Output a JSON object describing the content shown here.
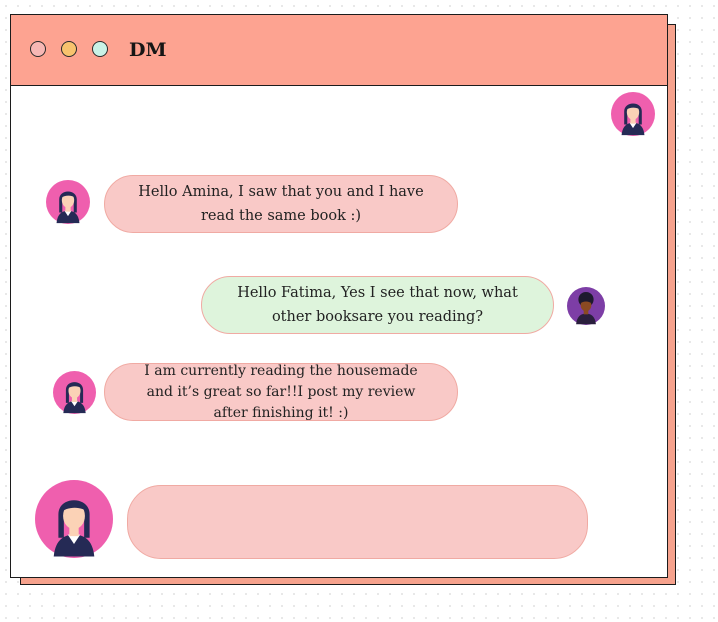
{
  "window": {
    "title": "DM",
    "controls": [
      "close-dot",
      "minimize-dot",
      "maximize-dot"
    ]
  },
  "colors": {
    "titlebar": "#fda391",
    "shadow_panel": "#f6a28d",
    "incoming_bubble": "#f9c9c7",
    "outgoing_bubble": "#def4dc",
    "avatar_pink": "#ef5fae",
    "avatar_purple": "#7d3ea6"
  },
  "messages": [
    {
      "sender": "Fatima",
      "side": "left",
      "text": "Hello Amina, I saw that you and I have read the same book :)"
    },
    {
      "sender": "Amina",
      "side": "right",
      "text": "Hello Fatima, Yes I see that now, what other booksare you reading?"
    },
    {
      "sender": "Fatima",
      "side": "left",
      "text": "I am currently reading the housemade and it’s  great so far!!I post my review after finishing it! :)"
    }
  ],
  "composer": {
    "value": "",
    "placeholder": ""
  }
}
